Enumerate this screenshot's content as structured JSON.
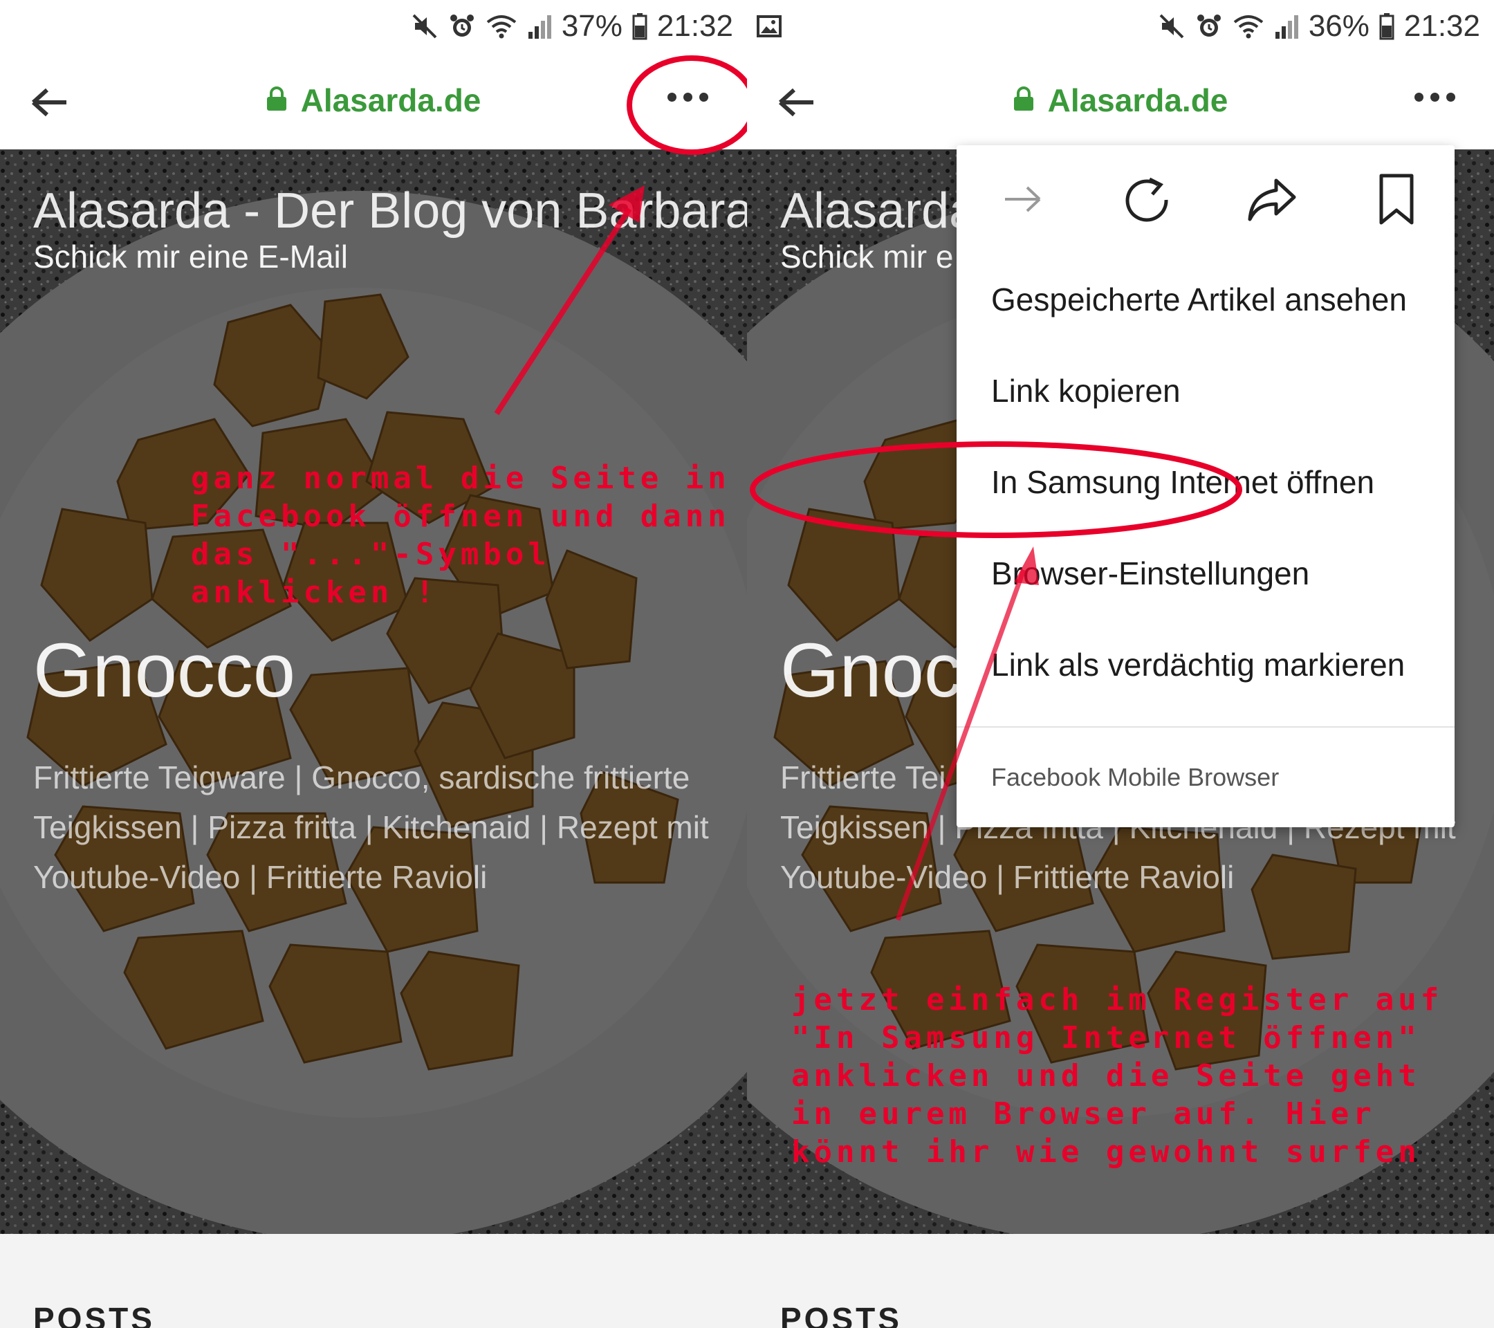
{
  "colors": {
    "site_green": "#3a9a3a",
    "annotation_red": "#e8002a",
    "hero_overlay": "#000000"
  },
  "left": {
    "status": {
      "battery": "37%",
      "time": "21:32"
    },
    "toolbar": {
      "site": "Alasarda.de",
      "back_icon": "arrow-left-icon",
      "more_icon": "more-horizontal-icon"
    },
    "hero": {
      "blog_title": "Alasarda - Der Blog von Barbara",
      "email_link": "Schick mir eine E-Mail",
      "post_title": "Gnocco",
      "tags": "Frittierte Teigware | Gnocco, sardische frittierte Teigkissen | Pizza fritta | Kitchenaid | Rezept mit Youtube-Video | Frittierte Ravioli"
    },
    "posts_label": "POSTS",
    "annotation": "ganz normal die Seite in\nFacebook öffnen und dann\ndas \"...\"-Symbol\nanklicken !"
  },
  "right": {
    "status": {
      "battery": "36%",
      "time": "21:32"
    },
    "toolbar": {
      "site": "Alasarda.de"
    },
    "hero": {
      "blog_title": "Alasarda",
      "email_link": "Schick mir e",
      "post_title": "Gnocc",
      "tags_line1": "Frittierte Tei",
      "tags_line2": "Teigkissen | Pizza fritta | Kitchenaid | Rezept mit",
      "tags_line3": "Youtube-Video | Frittierte Ravioli"
    },
    "posts_label": "POSTS",
    "menu": {
      "icons": [
        "forward-icon",
        "reload-icon",
        "share-icon",
        "bookmark-icon"
      ],
      "items": [
        "Gespeicherte Artikel ansehen",
        "Link kopieren",
        "In Samsung Internet öffnen",
        "Browser-Einstellungen",
        "Link als verdächtig markieren"
      ],
      "footer": "Facebook Mobile Browser"
    },
    "annotation": "jetzt einfach im Register auf\n\"In Samsung Internet öffnen\"\nanklicken und die Seite geht\nin eurem Browser auf. Hier\nkönnt ihr wie gewohnt surfen"
  }
}
